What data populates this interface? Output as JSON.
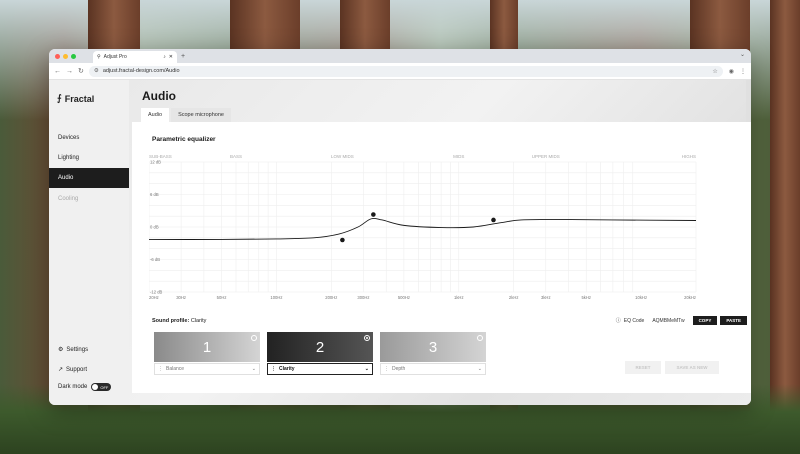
{
  "browser": {
    "tab_title": "Adjust Pro",
    "url": "adjust.fractal-design.com/Audio"
  },
  "sidebar": {
    "brand": "Fractal",
    "items": [
      {
        "label": "Devices",
        "state": "normal"
      },
      {
        "label": "Lighting",
        "state": "normal"
      },
      {
        "label": "Audio",
        "state": "active"
      },
      {
        "label": "Cooling",
        "state": "disabled"
      }
    ],
    "settings_label": "Settings",
    "support_label": "Support",
    "dark_mode_label": "Dark mode",
    "dark_mode_state": "OFF"
  },
  "main": {
    "title": "Audio",
    "tabs": [
      {
        "label": "Audio",
        "active": true
      },
      {
        "label": "Scope microphone",
        "active": false
      }
    ]
  },
  "equalizer": {
    "title": "Parametric equalizer",
    "band_labels": [
      "SUB-BASS",
      "BASS",
      "LOW MIDS",
      "MIDS",
      "UPPER MIDS",
      "HIGHS"
    ],
    "y_ticks": [
      "12 dB",
      "6 dB",
      "0 dB",
      "-6 dB",
      "-12 dB"
    ],
    "x_ticks": [
      "20Hz",
      "30Hz",
      "50Hz",
      "100Hz",
      "200Hz",
      "300Hz",
      "500Hz",
      "1kHz",
      "2kHz",
      "3kHz",
      "5kHz",
      "10kHz",
      "20kHz"
    ]
  },
  "chart_data": {
    "type": "line",
    "x_scale": "log",
    "xlim": [
      20,
      20000
    ],
    "ylim": [
      -12,
      12
    ],
    "curve": [
      {
        "x": 20,
        "y": -2.3
      },
      {
        "x": 50,
        "y": -2.3
      },
      {
        "x": 100,
        "y": -2.2
      },
      {
        "x": 160,
        "y": -2.0
      },
      {
        "x": 220,
        "y": -1.3
      },
      {
        "x": 280,
        "y": 0.0
      },
      {
        "x": 330,
        "y": 1.5
      },
      {
        "x": 380,
        "y": 1.3
      },
      {
        "x": 500,
        "y": 0.3
      },
      {
        "x": 800,
        "y": -0.1
      },
      {
        "x": 1200,
        "y": 0.0
      },
      {
        "x": 1700,
        "y": 0.8
      },
      {
        "x": 2200,
        "y": 1.3
      },
      {
        "x": 3500,
        "y": 1.4
      },
      {
        "x": 7000,
        "y": 1.3
      },
      {
        "x": 20000,
        "y": 1.2
      }
    ],
    "control_points": [
      {
        "x": 230,
        "y": -2.4
      },
      {
        "x": 340,
        "y": 2.3
      },
      {
        "x": 1550,
        "y": 1.3
      }
    ]
  },
  "sound_profile": {
    "label": "Sound profile:",
    "value": "Clarity",
    "eq_code_label": "EQ Code",
    "eq_code_value": "AQMBMeMTw",
    "copy_label": "COPY",
    "paste_label": "PASTE",
    "presets": [
      {
        "number": "1",
        "name": "Balance",
        "selected": false,
        "color": "#8a8a8a"
      },
      {
        "number": "2",
        "name": "Clarity",
        "selected": true,
        "color": "#222222"
      },
      {
        "number": "3",
        "name": "Depth",
        "selected": false,
        "color": "#9a9a9a"
      }
    ],
    "reset_label": "RESET",
    "save_as_new_label": "SAVE AS NEW"
  }
}
